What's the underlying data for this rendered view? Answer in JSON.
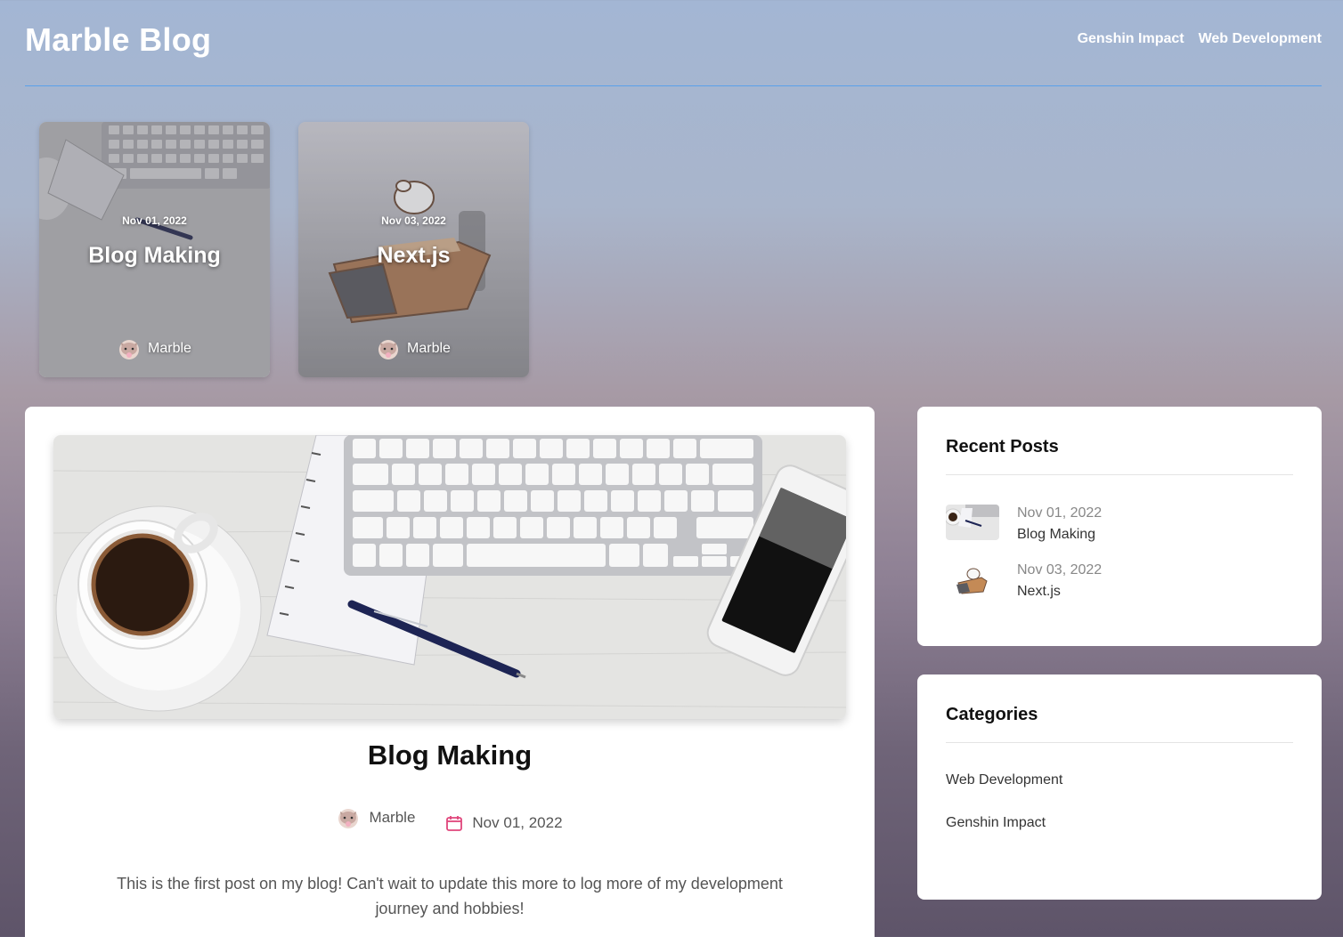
{
  "site": {
    "title": "Marble Blog"
  },
  "nav": {
    "items": [
      "Genshin Impact",
      "Web Development"
    ]
  },
  "featured": [
    {
      "date": "Nov 01, 2022",
      "title": "Blog Making",
      "author": "Marble"
    },
    {
      "date": "Nov 03, 2022",
      "title": "Next.js",
      "author": "Marble"
    }
  ],
  "post": {
    "title": "Blog Making",
    "author": "Marble",
    "date": "Nov 01, 2022",
    "body": "This is the first post on my blog! Can't wait to update this more to log more of my development journey and hobbies!"
  },
  "sidebar": {
    "recent": {
      "title": "Recent Posts",
      "items": [
        {
          "date": "Nov 01, 2022",
          "title": "Blog Making"
        },
        {
          "date": "Nov 03, 2022",
          "title": "Next.js"
        }
      ]
    },
    "categories": {
      "title": "Categories",
      "items": [
        "Web Development",
        "Genshin Impact"
      ]
    }
  },
  "colors": {
    "accent": "#5aa0ea",
    "calendar_icon": "#e0457b"
  }
}
